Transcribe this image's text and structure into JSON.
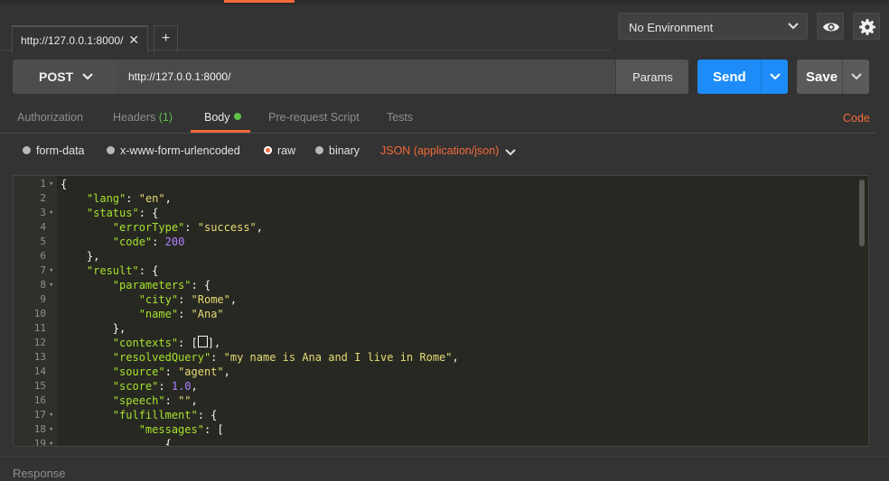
{
  "tabs": [
    {
      "label": "http://127.0.0.1:8000/",
      "close": "✕"
    }
  ],
  "new_tab": "+",
  "environment": {
    "selected": "No Environment"
  },
  "icons": {
    "eye": "eye-icon",
    "settings": "gear-icon"
  },
  "request": {
    "method": "POST",
    "url": "http://127.0.0.1:8000/",
    "params_label": "Params",
    "send_label": "Send",
    "save_label": "Save"
  },
  "subtabs": [
    {
      "label": "Authorization"
    },
    {
      "label": "Headers",
      "count": "(1)"
    },
    {
      "label": "Body"
    },
    {
      "label": "Pre-request Script"
    },
    {
      "label": "Tests"
    }
  ],
  "code_link": "Code",
  "body_types": [
    "form-data",
    "x-www-form-urlencoded",
    "raw",
    "binary"
  ],
  "body_selected": "raw",
  "content_type": "JSON (application/json)",
  "editor": {
    "lines": [
      "{",
      "    \"lang\": \"en\",",
      "    \"status\": {",
      "        \"errorType\": \"success\",",
      "        \"code\": 200",
      "    },",
      "    \"result\": {",
      "        \"parameters\": {",
      "            \"city\": \"Rome\",",
      "            \"name\": \"Ana\"",
      "        },",
      "        \"contexts\": [],",
      "        \"resolvedQuery\": \"my name is Ana and I live in Rome\",",
      "        \"source\": \"agent\",",
      "        \"score\": 1.0,",
      "        \"speech\": \"\",",
      "        \"fulfillment\": {",
      "            \"messages\": [",
      "                {"
    ],
    "foldable_lines": [
      1,
      3,
      7,
      8,
      17,
      18,
      19
    ]
  },
  "response_label": "Response",
  "colors": {
    "accent": "#f26b3a",
    "send": "#1d8cf8",
    "success": "#5fc04a"
  }
}
